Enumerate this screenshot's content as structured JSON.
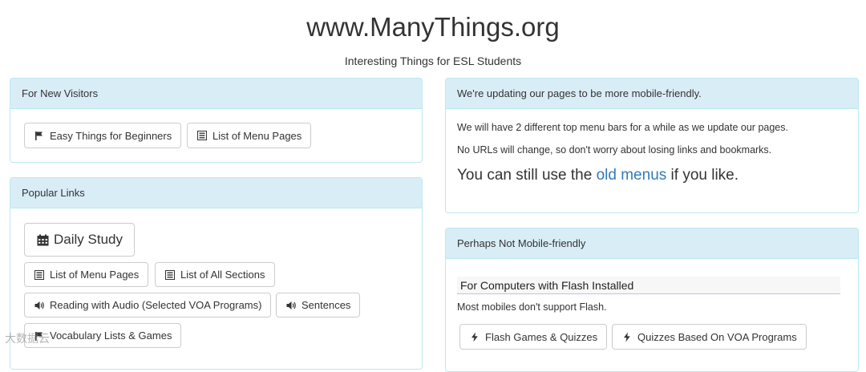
{
  "header": {
    "title": "www.ManyThings.org",
    "subtitle": "Interesting Things for ESL Students"
  },
  "new_visitors": {
    "heading": "For New Visitors",
    "buttons": [
      {
        "label": "Easy Things for Beginners",
        "icon": "flag-icon"
      },
      {
        "label": "List of Menu Pages",
        "icon": "list-icon"
      }
    ]
  },
  "popular_links": {
    "heading": "Popular Links",
    "daily_study": {
      "label": "Daily Study",
      "icon": "calendar-icon"
    },
    "buttons": [
      {
        "label": "List of Menu Pages",
        "icon": "list-icon"
      },
      {
        "label": "List of All Sections",
        "icon": "list-icon"
      },
      {
        "label": "Reading with Audio (Selected VOA Programs)",
        "icon": "volume-icon"
      },
      {
        "label": "Sentences",
        "icon": "volume-icon"
      },
      {
        "label": "Vocabulary Lists & Games",
        "icon": "flag-icon"
      }
    ]
  },
  "mobile_notice": {
    "heading": "We're updating our pages to be more mobile-friendly.",
    "line1": "We will have 2 different top menu bars for a while as we update our pages.",
    "line2": "No URLs will change, so don't worry about losing links and bookmarks.",
    "big_prefix": "You can still use the",
    "big_link": "old menus",
    "big_suffix": "if you like."
  },
  "not_mobile": {
    "heading": "Perhaps Not Mobile-friendly",
    "subheading": "For Computers with Flash Installed",
    "note": "Most mobiles don't support Flash.",
    "buttons": [
      {
        "label": "Flash Games & Quizzes",
        "icon": "bolt-icon"
      },
      {
        "label": "Quizzes Based On VOA Programs",
        "icon": "bolt-icon"
      }
    ]
  },
  "watermark": "大数据云"
}
